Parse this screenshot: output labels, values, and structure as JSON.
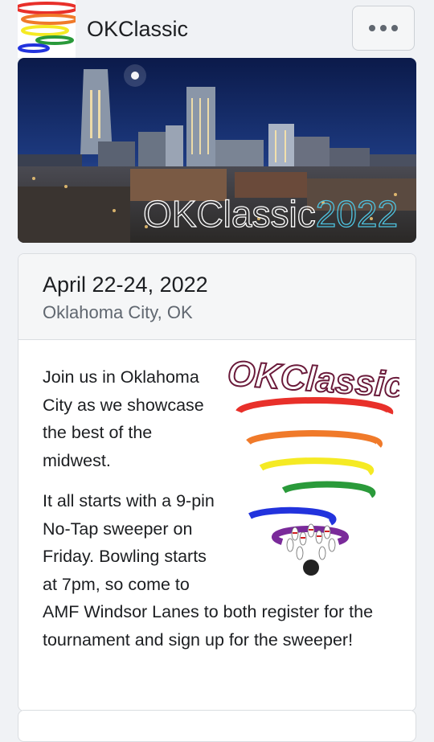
{
  "header": {
    "title": "OKClassic",
    "more_icon": "more-horizontal-icon"
  },
  "banner": {
    "title_main": "OKClassic",
    "title_year": "2022"
  },
  "event": {
    "date": "April 22-24, 2022",
    "location": "Oklahoma City, OK",
    "logo_text": "OKClassic",
    "paragraphs": [
      "Join us in Oklahoma City as we showcase the best of the midwest.",
      "It all starts with a 9-pin No-Tap sweeper on Friday. Bowling starts at 7pm, so come to AMF Windsor Lanes to both register for the tournament and sign up for the sweeper!"
    ]
  },
  "colors": {
    "rainbow": [
      "#e8302a",
      "#f07a2a",
      "#f5ea24",
      "#2a9a3a",
      "#2233dd",
      "#7a2a9a"
    ],
    "year_accent": "#4ec3e0"
  }
}
